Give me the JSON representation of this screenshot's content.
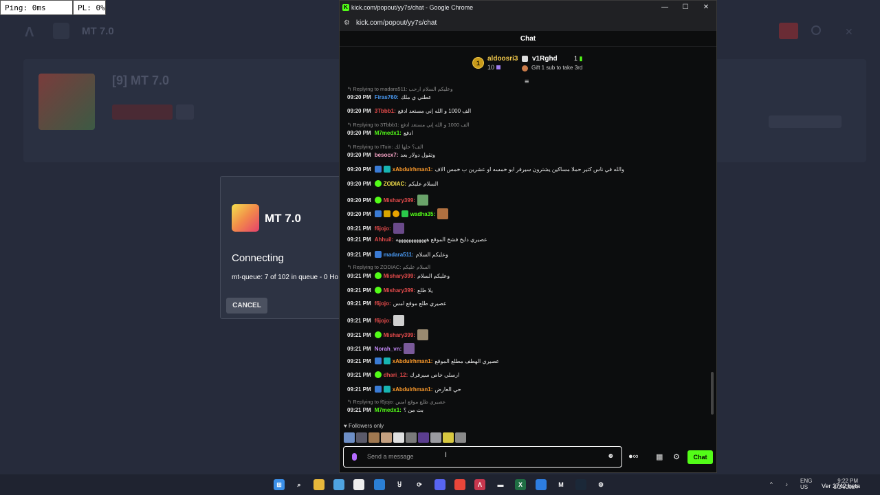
{
  "hud": {
    "ping": "Ping: 0ms",
    "pl": "PL: 0%"
  },
  "background_app": {
    "title": "MT 7.0",
    "server_name": "[9] MT 7.0"
  },
  "dialog": {
    "title": "MT 7.0",
    "status": "Connecting",
    "queue": "mt-queue: 7 of 102 in queue - 0 Ho",
    "cancel_label": "CANCEL"
  },
  "browser": {
    "window_title": "kick.com/popout/yy7s/chat - Google Chrome",
    "url": "kick.com/popout/yy7s/chat"
  },
  "chat": {
    "header": "Chat",
    "leaderboard": {
      "first_name": "aldoosri3",
      "first_rank": "1",
      "first_count": "10",
      "second_name": "v1Rghd",
      "second_count": "1",
      "gift_tip": "Gift 1 sub to take 3rd"
    },
    "messages": [
      {
        "type": "reply",
        "to": "madara511",
        "quote": "وعليكم السلام ارحب"
      },
      {
        "time": "09:20 PM",
        "user": "Firas760",
        "color": "#4a9cf7",
        "text": "عطني ي ملك"
      },
      {
        "time": "09:20 PM",
        "user": "3Tbbb1",
        "color": "#e54b4b",
        "text": "الف 1000 و الله إني مستعد ادفع"
      },
      {
        "type": "reply",
        "to": "3Tbbb1",
        "quote": "الف 1000 و الله إني مستعد ادفع"
      },
      {
        "time": "09:20 PM",
        "user": "M7medx1",
        "color": "#53fc18",
        "text": "ادفع"
      },
      {
        "type": "reply",
        "to": "ITuin",
        "quote": "الف؟ حلها لك"
      },
      {
        "time": "09:20 PM",
        "user": "besocx7",
        "color": "#f7a4c6",
        "text": "وتقول دولار بعد"
      },
      {
        "time": "09:20 PM",
        "user": "xAbdulrhman1",
        "color": "#ff9c2b",
        "text": "والله في ناس كثير حملا مساكين يشترون سيرفر ابو خمسه او عشرين ب خمس الاف"
      },
      {
        "time": "09:20 PM",
        "user": "ZODIAC",
        "color": "#f5e14b",
        "text": "السلام عليكم"
      },
      {
        "time": "09:20 PM",
        "user": "Mishary399",
        "color": "#e54b4b",
        "text": ""
      },
      {
        "time": "09:20 PM",
        "user": "wadha35",
        "color": "#53fc18",
        "text": ""
      },
      {
        "time": "09:21 PM",
        "user": "f6jojo",
        "color": "#e54b4b",
        "text": ""
      },
      {
        "time": "09:21 PM",
        "user": "Ahhuil",
        "color": "#e54b4b",
        "text": "عصيري دايخ فشخ الموقع ههههههههههههه"
      },
      {
        "time": "09:21 PM",
        "user": "madara511",
        "color": "#4a9cf7",
        "text": "وعليكم السلام"
      },
      {
        "type": "reply",
        "to": "ZODIAC",
        "quote": "السلام عليكم"
      },
      {
        "time": "09:21 PM",
        "user": "Mishary399",
        "color": "#e54b4b",
        "text": "وعليكم السلام"
      },
      {
        "time": "09:21 PM",
        "user": "Mishary399",
        "color": "#e54b4b",
        "text": "يلا طلع"
      },
      {
        "time": "09:21 PM",
        "user": "f6jojo",
        "color": "#e54b4b",
        "text": "عصيري طلع موقع امس"
      },
      {
        "time": "09:21 PM",
        "user": "f6jojo",
        "color": "#e54b4b",
        "text": ""
      },
      {
        "time": "09:21 PM",
        "user": "Mishary399",
        "color": "#e54b4b",
        "text": ""
      },
      {
        "time": "09:21 PM",
        "user": "Norah_vn",
        "color": "#c58af9",
        "text": ""
      },
      {
        "time": "09:21 PM",
        "user": "xAbdulrhman1",
        "color": "#ff9c2b",
        "text": "عصيري الهطف مطلع الموقع"
      },
      {
        "time": "09:21 PM",
        "user": "dhari_12",
        "color": "#e54b4b",
        "text": "ارسلي خاص سيرفرك"
      },
      {
        "time": "09:21 PM",
        "user": "xAbdulrhman1",
        "color": "#ff9c2b",
        "text": "حي العارض"
      },
      {
        "type": "reply",
        "to": "f6jojo",
        "quote": "عصيري طلع موقع امس"
      },
      {
        "time": "09:21 PM",
        "user": "M7medx1",
        "color": "#53fc18",
        "text": "بث من ؟"
      }
    ],
    "followers_only": "Followers only",
    "input_placeholder": "Send a message",
    "send_label": "Chat",
    "reply_prefix": "Replying to"
  },
  "taskbar": {
    "lang_top": "ENG",
    "lang_bottom": "US",
    "clock_time": "9:22 PM",
    "clock_date": "3/24/2024",
    "version": "Ver 2742 beta"
  },
  "colors": {
    "kick_green": "#53fc18",
    "bg": "#262b3b",
    "chat_bg": "#0c0d0e"
  }
}
